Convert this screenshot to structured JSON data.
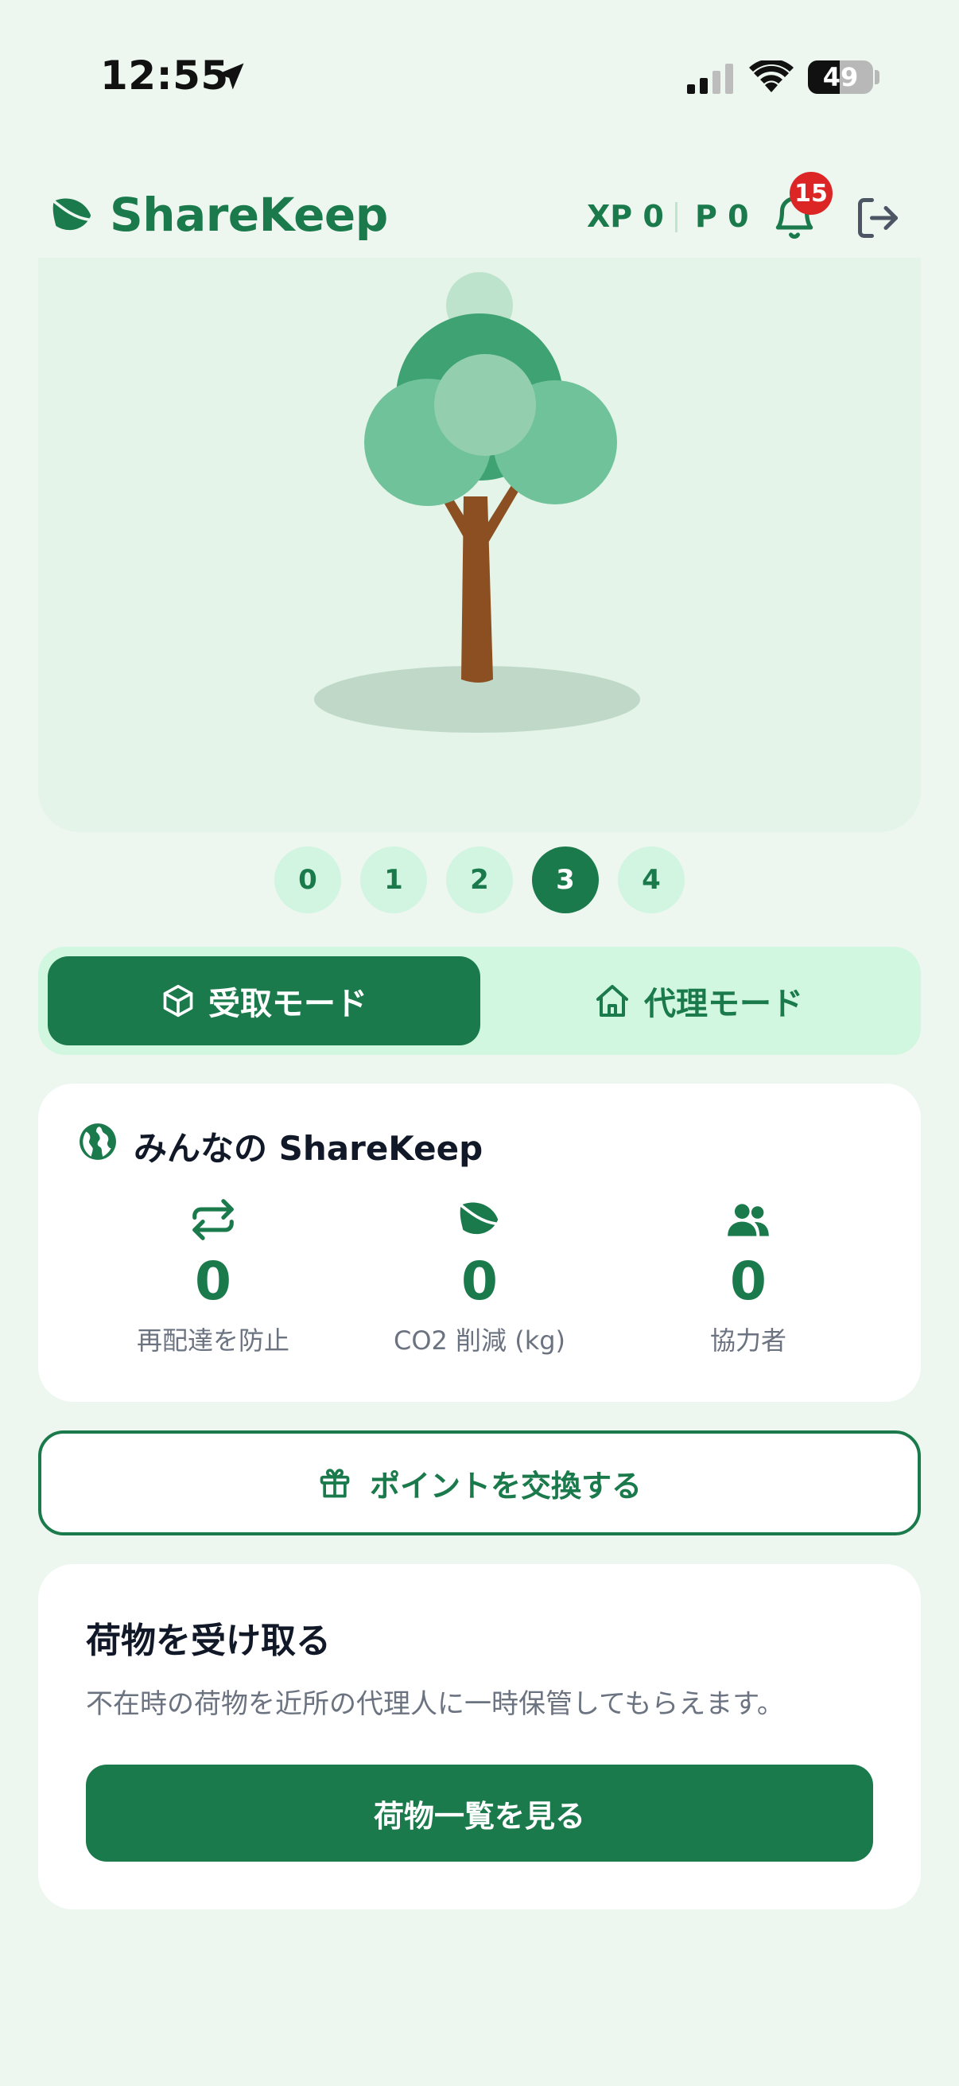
{
  "status_bar": {
    "time": "12:55",
    "battery": "49",
    "battery_level": 0.49
  },
  "header": {
    "app_name": "ShareKeep",
    "xp": "XP 0",
    "points": "P 0",
    "notification_count": "15",
    "icons": [
      "leaf-icon",
      "bell-icon",
      "logout-icon"
    ]
  },
  "levels": {
    "items": [
      "0",
      "1",
      "2",
      "3",
      "4"
    ],
    "selected": "3"
  },
  "modes": {
    "receive_label": "受取モード",
    "proxy_label": "代理モード",
    "active": "receive"
  },
  "community": {
    "title": "みんなの ShareKeep",
    "stats": [
      {
        "icon": "repeat-icon",
        "value": "0",
        "label": "再配達を防止"
      },
      {
        "icon": "leaf-icon",
        "value": "0",
        "label": "CO2 削減 (kg)"
      },
      {
        "icon": "users-icon",
        "value": "0",
        "label": "協力者"
      }
    ]
  },
  "exchange": {
    "label": "ポイントを交換する"
  },
  "receive_card": {
    "title": "荷物を受け取る",
    "description": "不在時の荷物を近所の代理人に一時保管してもらえます。",
    "button_label": "荷物一覧を見る"
  },
  "colors": {
    "primary": "#1B7A4B",
    "background": "#EDF7F0",
    "toggle_bg": "#D1F7E0",
    "badge": "#DC2626"
  }
}
